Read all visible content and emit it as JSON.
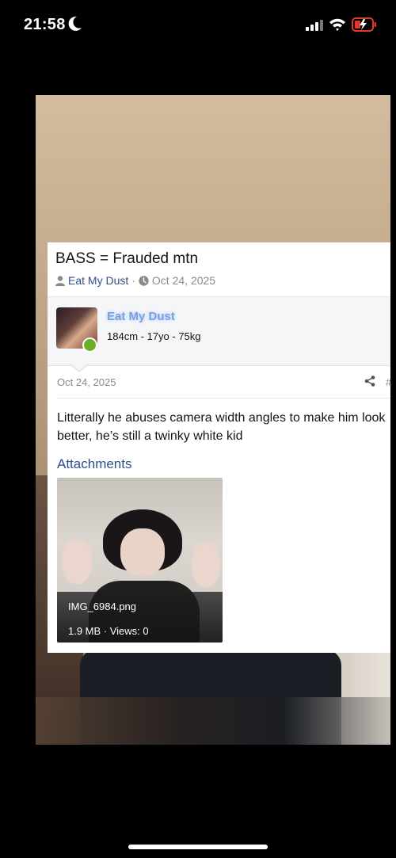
{
  "status_bar": {
    "time": "21:58",
    "icons": [
      "moon-icon",
      "cellular-signal-icon",
      "wifi-icon",
      "battery-charging-icon"
    ],
    "battery_color": "#e5372c"
  },
  "thread": {
    "title": "BASS = Frauded mtn",
    "author": "Eat My Dust",
    "separator": "·",
    "date": "Oct 24, 2025"
  },
  "author_block": {
    "username": "Eat My Dust",
    "stats": "184cm - 17yo - 75kg",
    "online": true
  },
  "post": {
    "date": "Oct 24, 2025",
    "number": "#",
    "body": "Litterally he abuses camera width angles to make him look better, he’s still a twinky white kid",
    "attachments_heading": "Attachments",
    "attachment": {
      "filename": "IMG_6984.png",
      "meta": "1.9 MB · Views: 0"
    }
  },
  "colors": {
    "link": "#2f4e8a",
    "username_glow": "#7aa0e0",
    "online": "#6ab020"
  }
}
